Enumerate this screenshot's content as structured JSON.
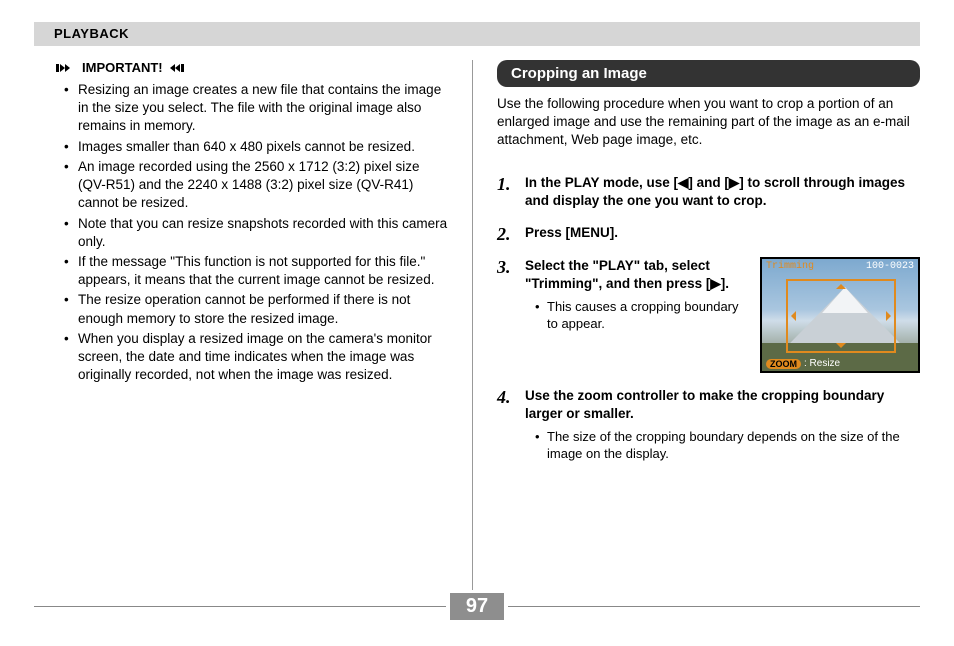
{
  "header": {
    "section": "PLAYBACK"
  },
  "left": {
    "important_label": "IMPORTANT!",
    "bullets": [
      "Resizing an image creates a new file that contains the image in the size you select. The file with the original image also remains in memory.",
      "Images smaller than 640 x 480 pixels cannot be resized.",
      "An image recorded using the 2560 x 1712 (3:2) pixel size (QV-R51) and the 2240 x 1488 (3:2) pixel size (QV-R41) cannot be resized.",
      "Note that you can resize snapshots recorded with this camera only.",
      "If the message \"This function is not supported for this file.\" appears, it means that the current image cannot be resized.",
      "The resize operation cannot be performed if there is not enough memory to store the resized image.",
      "When you display a resized image on the camera's monitor screen, the date and time indicates when the image was originally recorded, not when the image was resized."
    ]
  },
  "right": {
    "title": "Cropping an Image",
    "intro": "Use the following procedure when you want to crop a portion of an enlarged image and use the remaining part of the image as an e-mail attachment, Web page image, etc.",
    "steps": [
      {
        "num": "1.",
        "title": "In the PLAY mode, use [◀] and [▶] to scroll through images and display the one you want to crop."
      },
      {
        "num": "2.",
        "title": "Press [MENU]."
      },
      {
        "num": "3.",
        "title": "Select the \"PLAY\" tab, select \"Trimming\", and then press [▶].",
        "sub": "This causes a cropping boundary to appear."
      },
      {
        "num": "4.",
        "title": "Use the zoom controller to make the cropping boundary larger or smaller.",
        "sub": "The size of the cropping boundary depends on the size of the image on the display."
      }
    ],
    "osd": {
      "trimming": "Trimming",
      "counter": "100-0023",
      "zoom": "ZOOM",
      "resize": ": Resize"
    }
  },
  "footer": {
    "page": "97"
  }
}
